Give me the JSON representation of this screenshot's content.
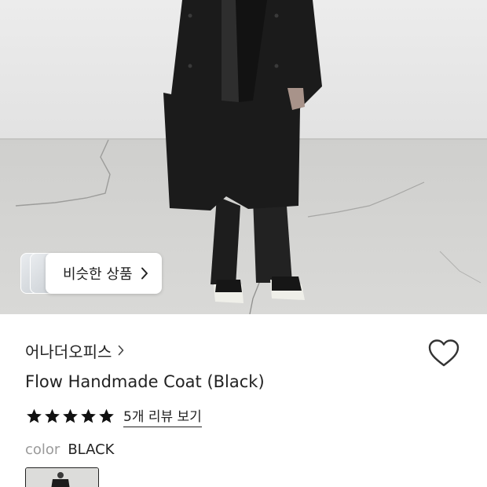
{
  "product": {
    "similar_button_label": "비슷한 상품",
    "brand_name": "어나더오피스",
    "title": "Flow Handmade Coat (Black)",
    "rating": 5,
    "review_link_label": "5개 리뷰 보기",
    "color_label": "color",
    "color_value": "BLACK"
  },
  "icons": {
    "similar_chevron": "chevron-right-icon",
    "brand_chevron": "chevron-right-icon",
    "wishlist": "heart-outline-icon",
    "rating_star": "star-filled-icon"
  },
  "colors": {
    "text": "#222222",
    "muted": "#9a9a9a",
    "star": "#111111"
  }
}
